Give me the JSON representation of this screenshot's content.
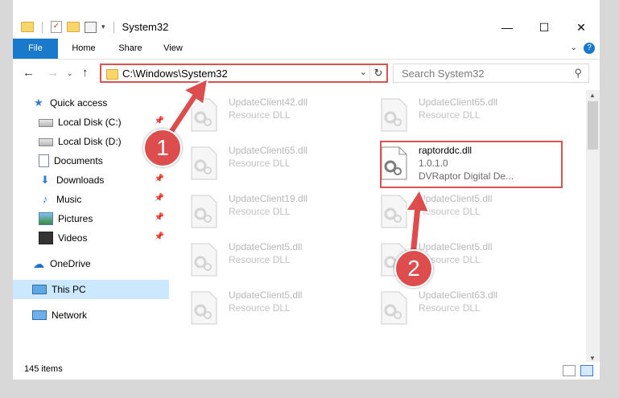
{
  "window": {
    "title": "System32",
    "controls": {
      "minimize": "—",
      "maximize": "☐",
      "close": "✕"
    }
  },
  "ribbon": {
    "tabs": [
      "File",
      "Home",
      "Share",
      "View"
    ],
    "collapse_glyph": "⌄",
    "help_glyph": "?"
  },
  "address": {
    "path": "C:\\Windows\\System32",
    "dropdown_glyph": "⌄",
    "refresh_glyph": "↻"
  },
  "search": {
    "placeholder": "Search System32",
    "icon": "search-icon"
  },
  "nav_glyphs": {
    "back": "←",
    "forward": "→",
    "recent": "⌄",
    "up": "↑"
  },
  "sidebar": {
    "items": [
      {
        "label": "Quick access",
        "icon": "star-icon"
      },
      {
        "label": "Local Disk (C:)",
        "icon": "disk-icon",
        "pinned": true
      },
      {
        "label": "Local Disk (D:)",
        "icon": "disk-icon",
        "pinned": true
      },
      {
        "label": "Documents",
        "icon": "documents-icon",
        "pinned": true
      },
      {
        "label": "Downloads",
        "icon": "downloads-icon",
        "pinned": true
      },
      {
        "label": "Music",
        "icon": "music-icon",
        "pinned": true
      },
      {
        "label": "Pictures",
        "icon": "pictures-icon",
        "pinned": true
      },
      {
        "label": "Videos",
        "icon": "videos-icon",
        "pinned": true
      },
      {
        "label": "OneDrive",
        "icon": "onedrive-icon"
      },
      {
        "label": "This PC",
        "icon": "pc-icon",
        "selected": true
      },
      {
        "label": "Network",
        "icon": "network-icon"
      }
    ]
  },
  "files": [
    {
      "name": "UpdateClient42.dll",
      "type": "Resource DLL"
    },
    {
      "name": "UpdateClient65.dll",
      "type": "Resource DLL"
    },
    {
      "name": "UpdateClient65.dll",
      "type": "Resource DLL"
    },
    {
      "name": "raptorddc.dll",
      "version": "1.0.1.0",
      "description": "DVRaptor Digital De...",
      "highlighted": true
    },
    {
      "name": "UpdateClient19.dll",
      "type": "Resource DLL"
    },
    {
      "name": "UpdateClient5.dll",
      "type": "Resource DLL"
    },
    {
      "name": "UpdateClient5.dll",
      "type": "Resource DLL"
    },
    {
      "name": "UpdateClient5.dll",
      "type": "Resource DLL"
    },
    {
      "name": "UpdateClient5.dll",
      "type": "Resource DLL"
    },
    {
      "name": "UpdateClient63.dll",
      "type": "Resource DLL"
    }
  ],
  "status": {
    "item_count": "145 items"
  },
  "annotations": {
    "badge1": "1",
    "badge2": "2",
    "color": "#dd4d4d"
  },
  "colors": {
    "accent": "#1979ca",
    "highlight_border": "#d9534f",
    "selection": "#cce8ff"
  }
}
